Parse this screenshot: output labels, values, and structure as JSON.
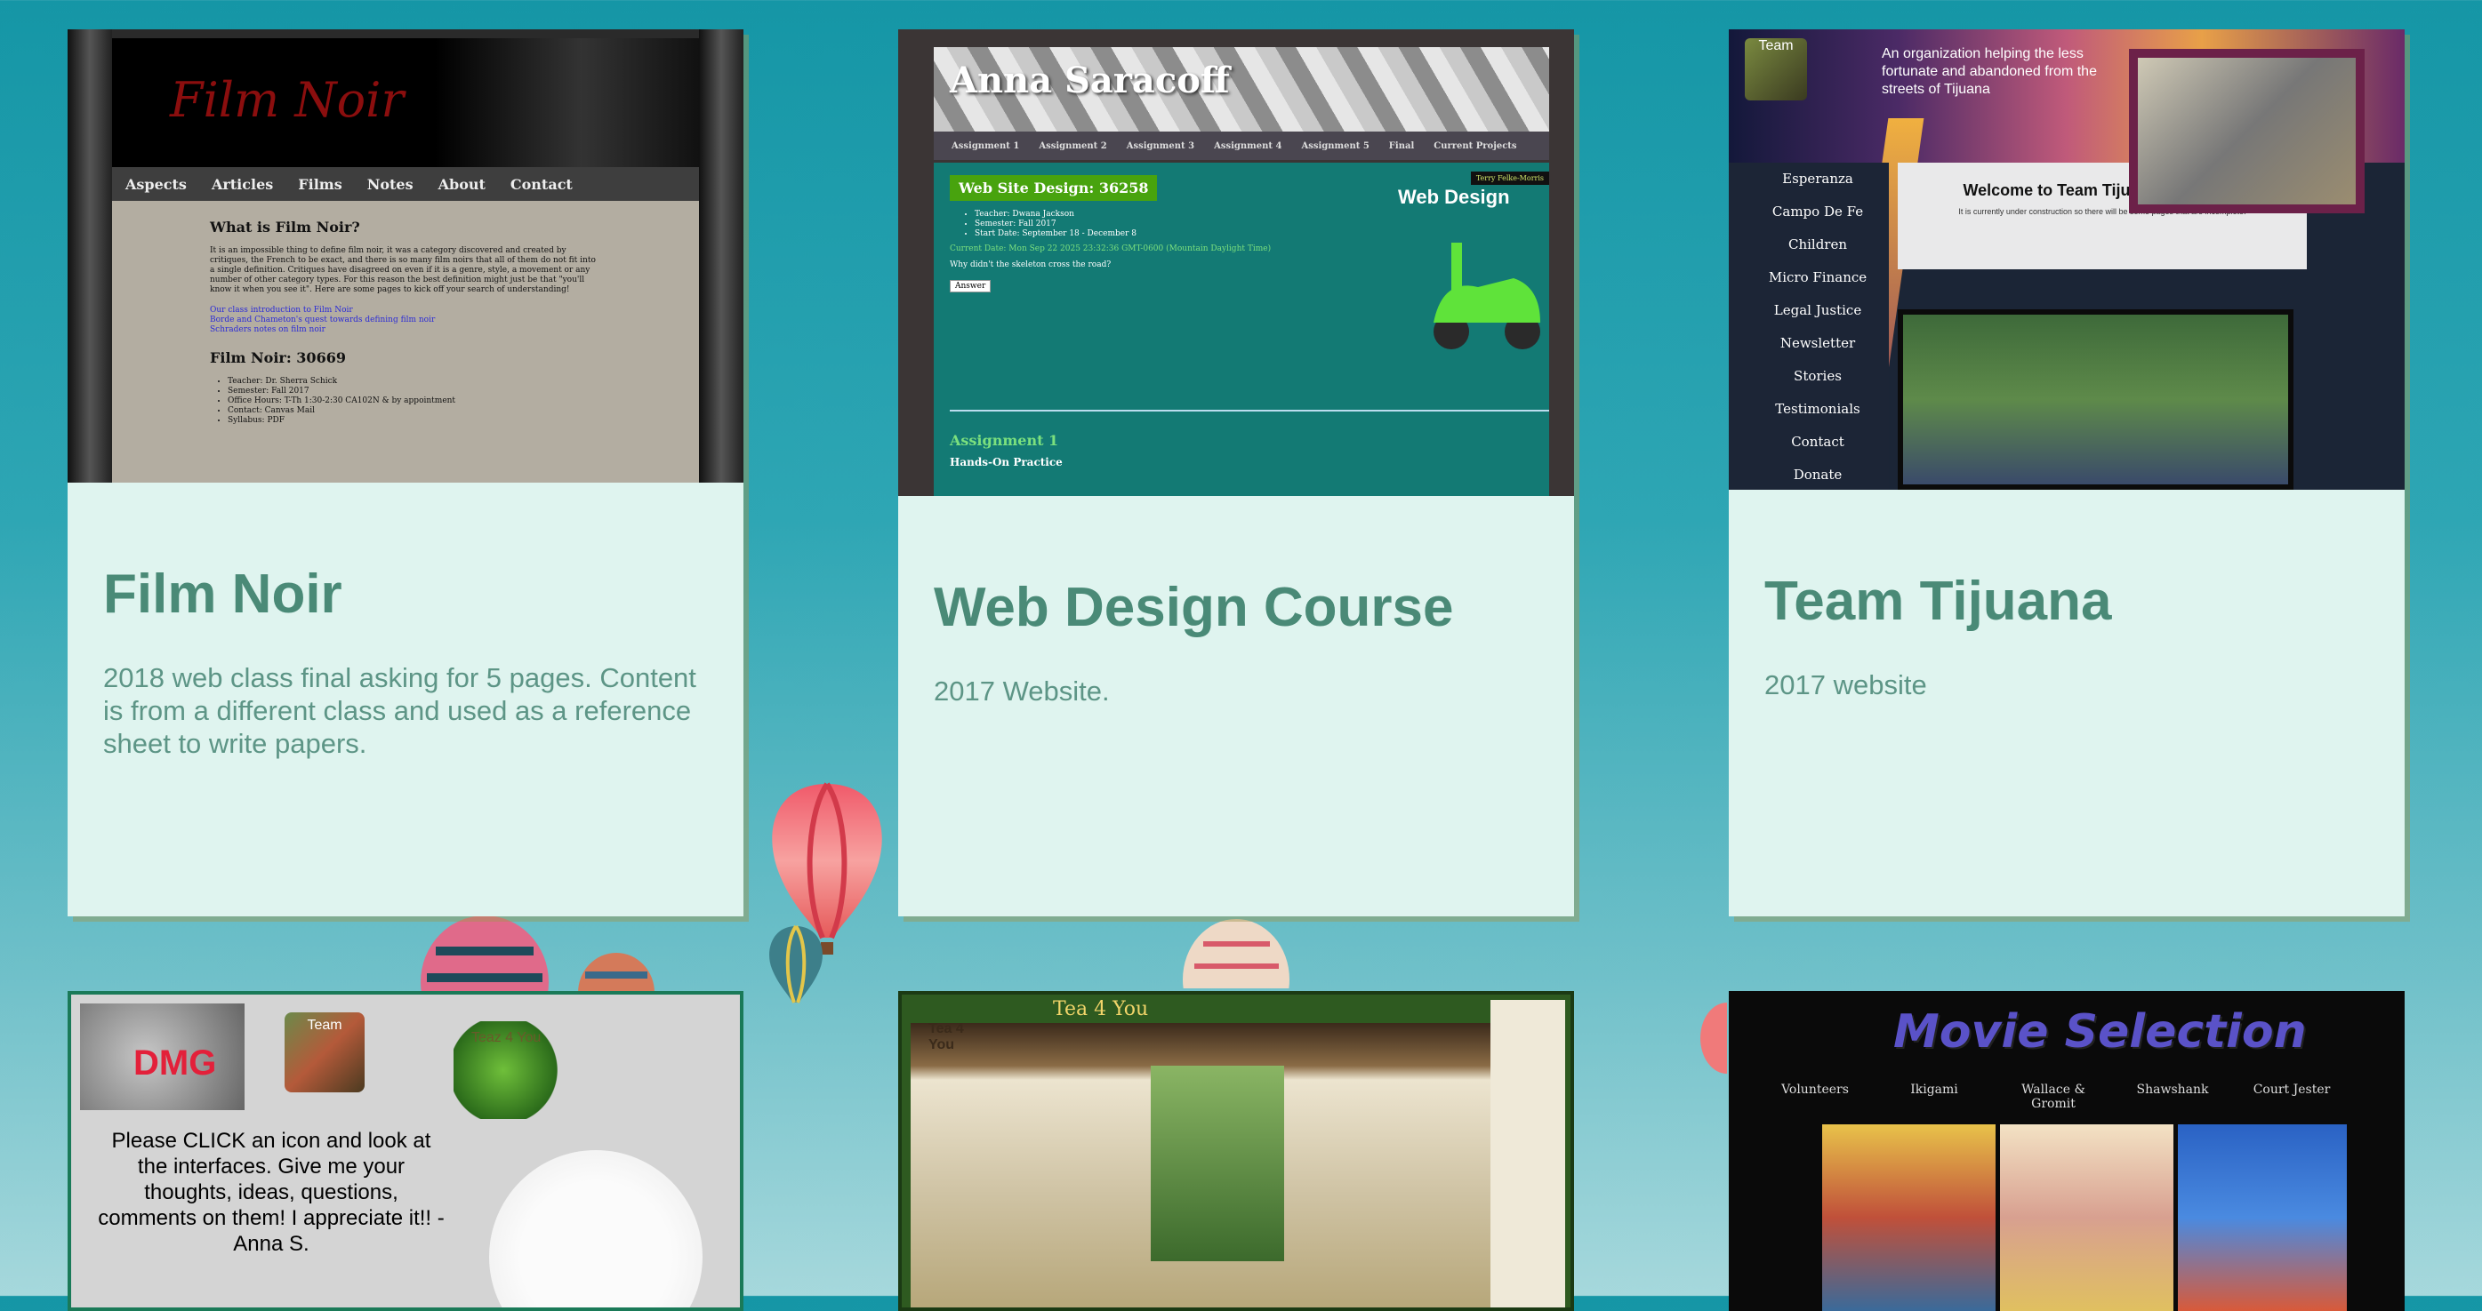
{
  "cards": [
    {
      "title": "Film Noir",
      "description": "2018 web class final asking for 5 pages. Content is from a different class and used as a reference sheet to write papers.",
      "screenshot": {
        "banner": "Film Noir",
        "nav": [
          "Aspects",
          "Articles",
          "Films",
          "Notes",
          "About",
          "Contact"
        ],
        "heading": "What is Film Noir?",
        "intro": "It is an impossible thing to define film noir, it was a category discovered and created by critiques, the French to be exact, and there is so many film noirs that all of them do not fit into a single definition. Critiques have disagreed on even if it is a genre, style, a movement or any number of other category types. For this reason the best definition might just be that \"you'll know it when you see it\". Here are some pages to kick off your search of understanding!",
        "links": [
          "Our class introduction to Film Noir",
          "Borde and Chameton's quest towards defining film noir",
          "Schraders notes on film noir"
        ],
        "course": "Film Noir: 30669",
        "details": [
          "Teacher: Dr. Sherra Schick",
          "Semester: Fall 2017",
          "Office Hours: T-Th 1:30-2:30 CA102N & by appointment",
          "Contact: Canvas Mail",
          "Syllabus: PDF"
        ]
      }
    },
    {
      "title": "Web Design Course",
      "description": "2017 Website.",
      "screenshot": {
        "header": "Anna Saracoff",
        "nav": [
          "Assignment 1",
          "Assignment 2",
          "Assignment 3",
          "Assignment 4",
          "Assignment 5",
          "Final",
          "Current Projects"
        ],
        "course": "Web Site Design: 36258",
        "details": [
          "Teacher: Dwana Jackson",
          "Semester: Fall 2017",
          "Start Date: September 18 - December 8"
        ],
        "date": "Current Date: Mon Sep 22 2025 23:32:36 GMT-0600 (Mountain Daylight Time)",
        "question": "Why didn't the skeleton cross the road?",
        "answer_button": "Answer",
        "section": "Assignment 1",
        "subsection": "Hands-On Practice",
        "promo_title": "Web Design",
        "promo_tag": "Terry Felke-Morris"
      }
    },
    {
      "title": "Team Tijuana",
      "description": "2017 website",
      "screenshot": {
        "logo": "Team",
        "blurb": "An organization helping the less fortunate and abandoned from the streets of Tijuana",
        "menu": [
          "Esperanza",
          "Campo De Fe",
          "Children",
          "Micro Finance",
          "Legal Justice",
          "Newsletter",
          "Stories",
          "Testimonials",
          "Contact",
          "Donate"
        ],
        "welcome": "Welcome to Team Tijuana's Website!",
        "notice": "It is currently under construction so there will be some pages that are incomplete."
      }
    },
    {
      "screenshot": {
        "badge": "DMG",
        "team_logo": "Team",
        "teaz_logo": "Teaz 4 You",
        "message": "Please CLICK an icon and look at the interfaces. Give me your thoughts, ideas, questions, comments on them! I appreciate it!! -Anna S."
      }
    },
    {
      "screenshot": {
        "title": "Tea 4 You",
        "logo": "Tea 4 You"
      }
    },
    {
      "screenshot": {
        "title": "Movie Selection",
        "nav": [
          "Volunteers",
          "Ikigami",
          "Wallace & Gromit",
          "Shawshank",
          "Court Jester"
        ]
      }
    }
  ]
}
